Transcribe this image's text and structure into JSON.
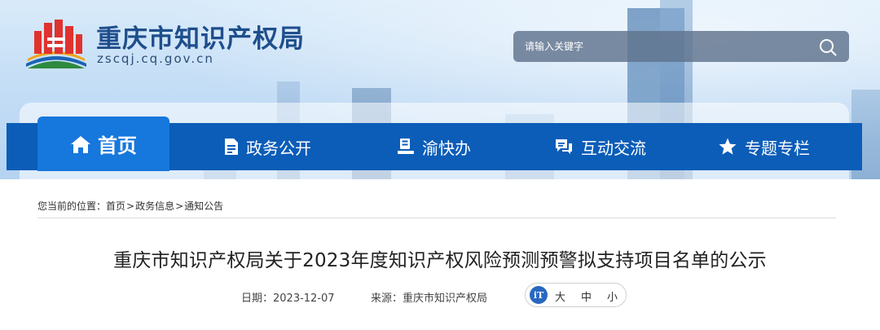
{
  "header": {
    "site_title": "重庆市知识产权局",
    "site_domain": "zscqj.cq.gov.cn",
    "logo_icon": "chongqing-ipo-emblem-icon",
    "search": {
      "placeholder": "请输入关键字",
      "icon": "search-icon"
    }
  },
  "nav": {
    "items": [
      {
        "label": "首页",
        "icon": "home-icon",
        "active": true
      },
      {
        "label": "政务公开",
        "icon": "document-icon"
      },
      {
        "label": "渝快办",
        "icon": "stamp-icon"
      },
      {
        "label": "互动交流",
        "icon": "chat-icon"
      },
      {
        "label": "专题专栏",
        "icon": "star-icon"
      }
    ],
    "active_color": "#1677dc",
    "bar_color": "#0b5db8"
  },
  "breadcrumb": {
    "prefix": "您当前的位置：",
    "items": [
      "首页",
      "政务信息",
      "通知公告"
    ],
    "separator": ">"
  },
  "article": {
    "title": "重庆市知识产权局关于2023年度知识产权风险预测预警拟支持项目名单的公示",
    "date_label": "日期：",
    "date": "2023-12-07",
    "source_label": "来源：",
    "source": "重庆市知识产权局"
  },
  "font_size_control": {
    "icon_text": "iT",
    "options": [
      "大",
      "中",
      "小"
    ]
  }
}
